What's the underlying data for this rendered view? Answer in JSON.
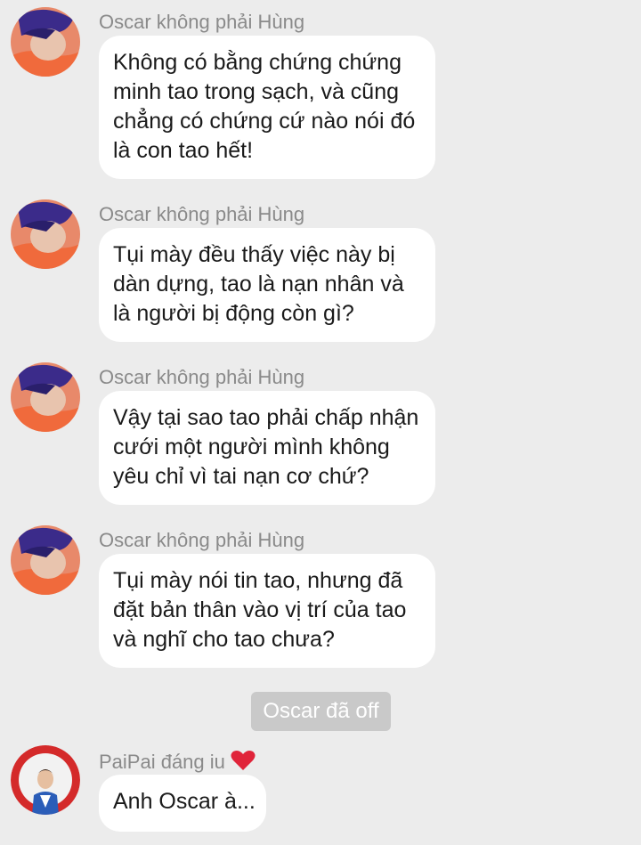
{
  "messages": [
    {
      "sender": "Oscar không phải Hùng",
      "lines": [
        "Không có bằng chứng chứng",
        "minh tao trong sạch, và cũng",
        "chẳng có chứng cứ nào nói đó",
        "là con tao hết!"
      ],
      "avatar": "oscar-avatar"
    },
    {
      "sender": "Oscar không phải Hùng",
      "lines": [
        "Tụi mày đều thấy việc này bị",
        "dàn dựng, tao là nạn nhân và",
        "là người bị động còn gì?"
      ],
      "avatar": "oscar-avatar"
    },
    {
      "sender": "Oscar không phải Hùng",
      "lines": [
        "Vậy tại sao tao phải chấp nhận",
        "cưới một người mình không",
        "yêu chỉ vì tai nạn cơ chứ?"
      ],
      "avatar": "oscar-avatar"
    },
    {
      "sender": "Oscar không phải Hùng",
      "lines": [
        "Tụi mày nói tin tao, nhưng đã",
        "đặt bản thân vào vị trí của tao",
        "và nghĩ cho tao chưa?"
      ],
      "avatar": "oscar-avatar"
    }
  ],
  "status_text": "Oscar đã off",
  "last_message": {
    "sender": "PaiPai đáng iu",
    "sender_icon": "heart-icon",
    "text": "Anh Oscar à...",
    "avatar": "paipai-avatar"
  },
  "colors": {
    "background": "#ececec",
    "bubble": "#ffffff",
    "sender_text": "#8a8a8a",
    "status_bg": "#c9c9c9",
    "heart": "#e0243a"
  }
}
